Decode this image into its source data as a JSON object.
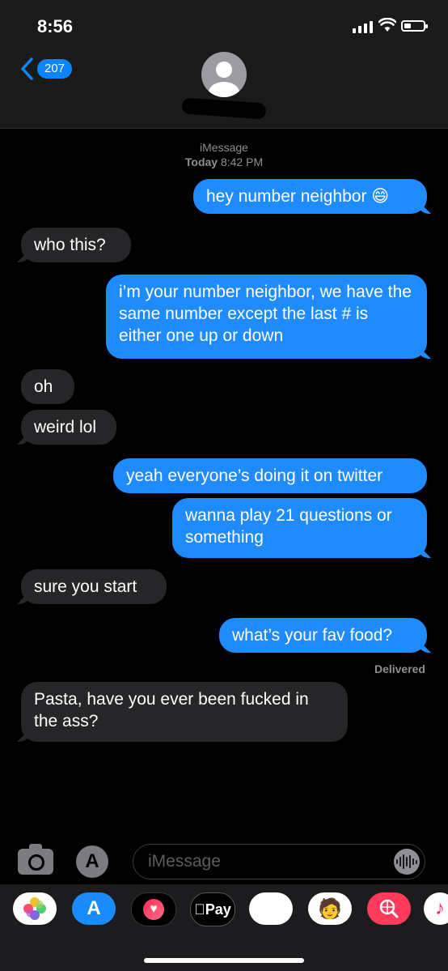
{
  "status_bar": {
    "time": "8:56",
    "battery_level": 0.35
  },
  "header": {
    "back_count": "207",
    "contact_visible": "S·· 1 ›"
  },
  "thread_meta": {
    "service": "iMessage",
    "day": "Today",
    "time": "8:42 PM"
  },
  "messages": [
    {
      "from": "me",
      "text": "hey number neighbor 😄"
    },
    {
      "from": "them",
      "text": "who this?"
    },
    {
      "from": "me",
      "text": "i’m your number neighbor, we have the same number except the last # is either one up or down"
    },
    {
      "from": "them",
      "text": "oh"
    },
    {
      "from": "them",
      "text": "weird lol"
    },
    {
      "from": "me",
      "text": "yeah everyone’s doing it on twitter"
    },
    {
      "from": "me",
      "text": "wanna play 21 questions or something"
    },
    {
      "from": "them",
      "text": "sure you start"
    },
    {
      "from": "me",
      "text": "what’s your fav food?"
    },
    {
      "from": "them",
      "text": "Pasta, have you ever been fucked in the ass?"
    }
  ],
  "delivered_label": "Delivered",
  "composer": {
    "placeholder": "iMessage"
  },
  "app_drawer": {
    "apple_pay_label": "Pay",
    "apps": [
      "photos-icon",
      "app-store-icon",
      "digital-touch-icon",
      "apple-pay-icon",
      "monkey-animoji-icon",
      "memoji-icon",
      "web-search-icon",
      "music-icon"
    ]
  },
  "colors": {
    "outgoing": "#1f8bff",
    "incoming": "#262628",
    "background": "#000000"
  }
}
